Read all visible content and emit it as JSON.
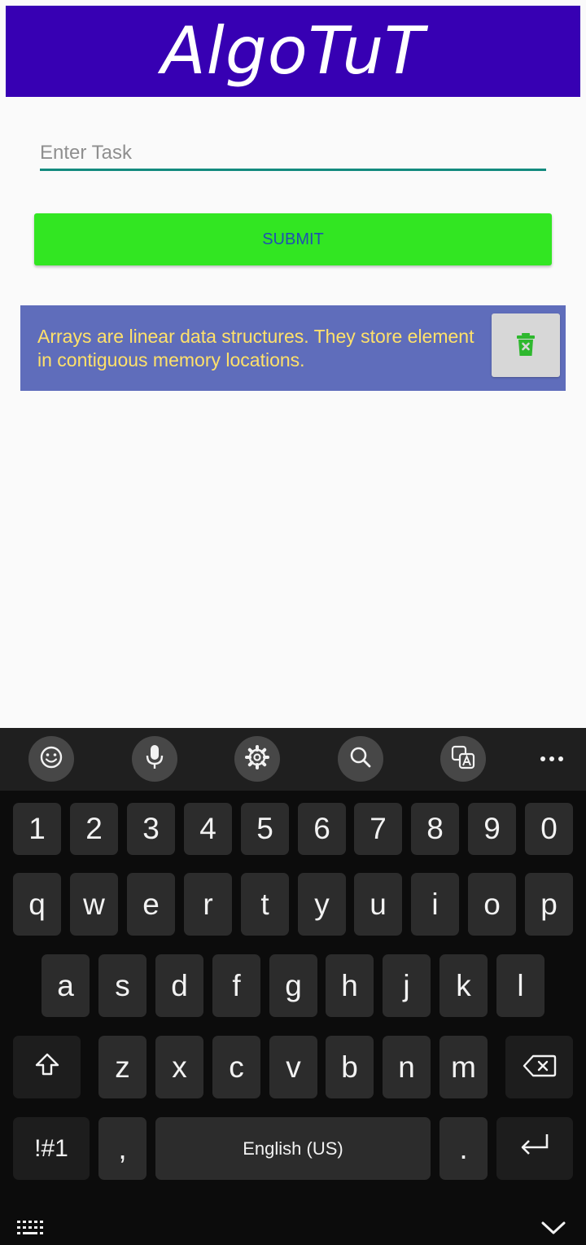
{
  "app": {
    "title": "AlgoTuT"
  },
  "form": {
    "placeholder": "Enter Task",
    "submit_label": "SUBMIT"
  },
  "tasks": [
    {
      "text": "Arrays are linear data structures. They store element in contiguous memory locations."
    }
  ],
  "colors": {
    "header": "#3700b3",
    "submit": "#32e622",
    "card": "#5f6dbb",
    "card_text": "#ffe16a",
    "input_underline": "#138a7e"
  },
  "keyboard": {
    "toolbar_icons": [
      "emoji-icon",
      "microphone-icon",
      "settings-icon",
      "search-icon",
      "translate-icon",
      "more-icon"
    ],
    "row_numbers": [
      "1",
      "2",
      "3",
      "4",
      "5",
      "6",
      "7",
      "8",
      "9",
      "0"
    ],
    "row_top": [
      "q",
      "w",
      "e",
      "r",
      "t",
      "y",
      "u",
      "i",
      "o",
      "p"
    ],
    "row_middle": [
      "a",
      "s",
      "d",
      "f",
      "g",
      "h",
      "j",
      "k",
      "l"
    ],
    "row_bottom": [
      "z",
      "x",
      "c",
      "v",
      "b",
      "n",
      "m"
    ],
    "symbols_label": "!#1",
    "comma_label": ",",
    "space_label": "English (US)",
    "period_label": "."
  }
}
